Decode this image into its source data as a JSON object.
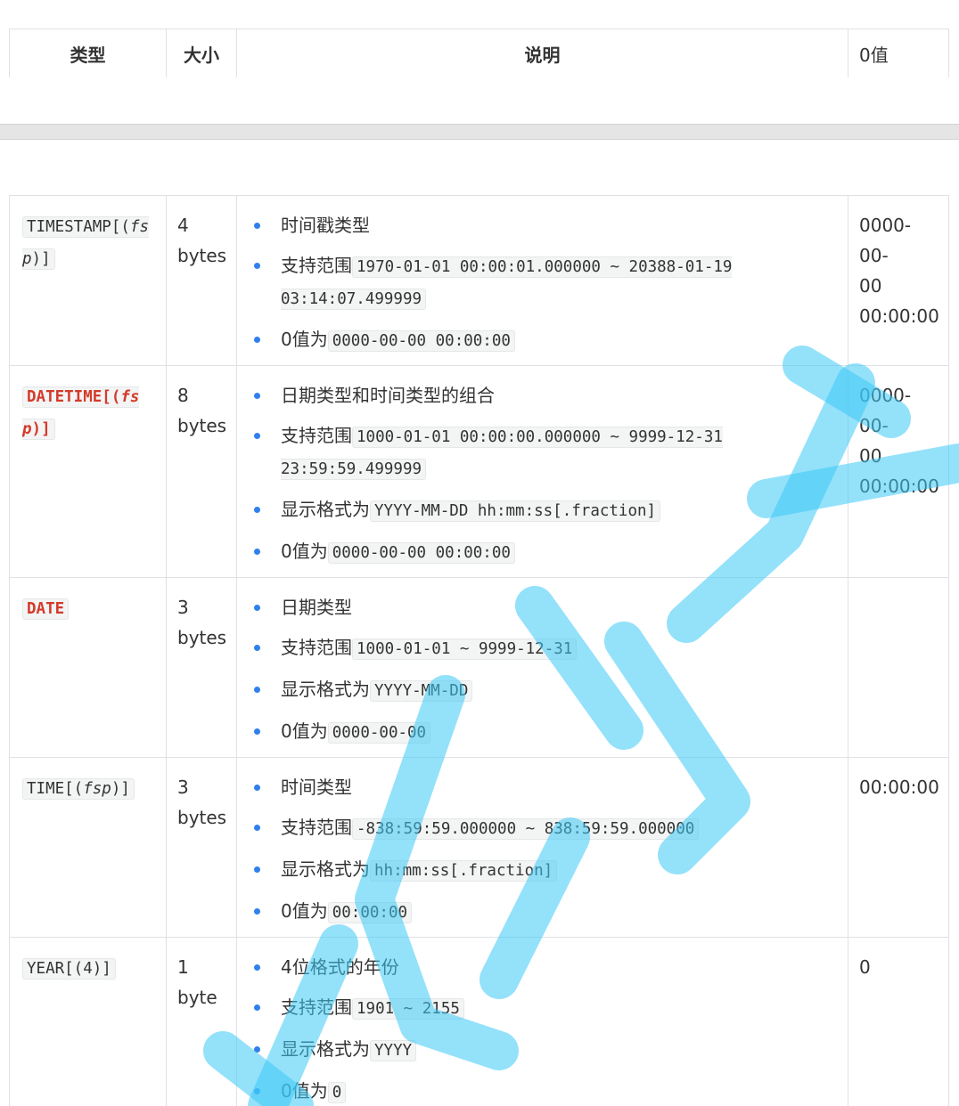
{
  "header": {
    "col_type": "类型",
    "col_size": "大小",
    "col_desc": "说明",
    "col_zero": "0值"
  },
  "rows": [
    {
      "type_html": "TIMESTAMP[(<i>fsp</i>)]",
      "type_red": false,
      "size": "4\nbytes",
      "items": [
        {
          "text": "时间戳类型",
          "code": ""
        },
        {
          "text": "支持范围",
          "code": "1970-01-01 00:00:01.000000 ~ 20388-01-19 03:14:07.499999"
        },
        {
          "text": "0值为",
          "code": "0000-00-00 00:00:00"
        }
      ],
      "zero": "0000-00-\n00\n00:00:00"
    },
    {
      "type_html": "DATETIME[(<i>fsp</i>)]",
      "type_red": true,
      "size": "8\nbytes",
      "items": [
        {
          "text": "日期类型和时间类型的组合",
          "code": ""
        },
        {
          "text": "支持范围",
          "code": "1000-01-01 00:00:00.000000 ~ 9999-12-31 23:59:59.499999"
        },
        {
          "text": "显示格式为",
          "code": "YYYY-MM-DD hh:mm:ss[.fraction]"
        },
        {
          "text": "0值为",
          "code": "0000-00-00 00:00:00"
        }
      ],
      "zero": "0000-00-\n00\n00:00:00"
    },
    {
      "type_html": "DATE",
      "type_red": true,
      "size": "3\nbytes",
      "items": [
        {
          "text": "日期类型",
          "code": ""
        },
        {
          "text": "支持范围",
          "code": "1000-01-01 ~ 9999-12-31"
        },
        {
          "text": "显示格式为",
          "code": "YYYY-MM-DD"
        },
        {
          "text": "0值为",
          "code": "0000-00-00"
        }
      ],
      "zero": ""
    },
    {
      "type_html": "TIME[(<i>fsp</i>)]",
      "type_red": false,
      "size": "3\nbytes",
      "items": [
        {
          "text": "时间类型",
          "code": ""
        },
        {
          "text": "支持范围",
          "code": "-838:59:59.000000 ~ 838:59:59.000000"
        },
        {
          "text": "显示格式为",
          "code": "hh:mm:ss[.fraction]"
        },
        {
          "text": "0值为",
          "code": "00:00:00"
        }
      ],
      "zero": "00:00:00"
    },
    {
      "type_html": "YEAR[(4)]",
      "type_red": false,
      "size": "1\nbyte",
      "items": [
        {
          "text": "4位格式的年份",
          "code": ""
        },
        {
          "text": "支持范围",
          "code": "1901 ~ 2155"
        },
        {
          "text": "显示格式为",
          "code": "YYYY"
        },
        {
          "text": "0值为",
          "code": "0"
        }
      ],
      "zero": "0"
    }
  ],
  "colors": {
    "bullet": "#2f80ed",
    "code_red": "#d43a2a",
    "watermark": "#3cc8f5"
  }
}
